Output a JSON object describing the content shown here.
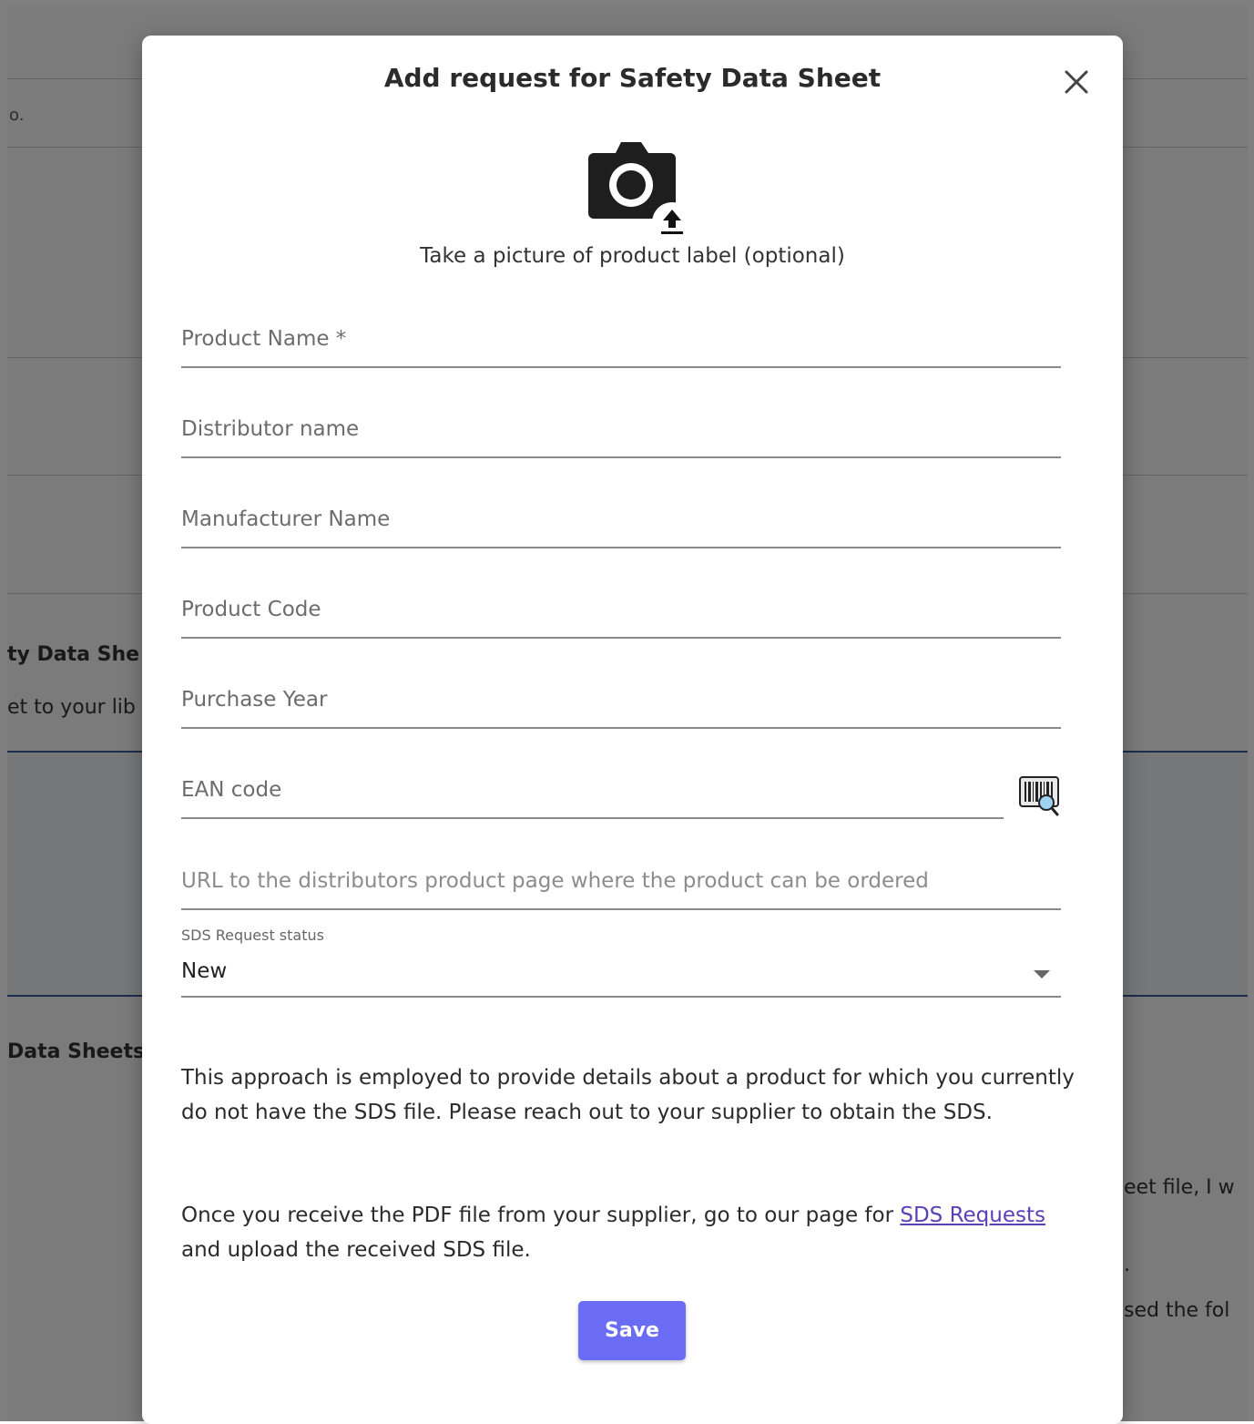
{
  "background": {
    "fragments": [
      {
        "text": "o."
      },
      {
        "text": "ty Data She"
      },
      {
        "text": "et to your lib"
      },
      {
        "text": "Data Sheets"
      },
      {
        "text": "eet file, I w"
      },
      {
        "text": "."
      },
      {
        "text": "sed the fol"
      }
    ]
  },
  "modal": {
    "title": "Add request for Safety Data Sheet",
    "photo_caption": "Take a picture of product label (optional)",
    "fields": {
      "product_name": {
        "placeholder": "Product Name *",
        "value": ""
      },
      "distributor_name": {
        "placeholder": "Distributor name",
        "value": ""
      },
      "manufacturer_name": {
        "placeholder": "Manufacturer Name",
        "value": ""
      },
      "product_code": {
        "placeholder": "Product Code",
        "value": ""
      },
      "purchase_year": {
        "placeholder": "Purchase Year",
        "value": ""
      },
      "ean_code": {
        "placeholder": "EAN code",
        "value": ""
      },
      "url": {
        "placeholder": "URL to the distributors product page where the product can be ordered",
        "value": ""
      }
    },
    "status": {
      "label": "SDS Request status",
      "value": "New"
    },
    "info": {
      "paragraph1": "This approach is employed to provide details about a product for which you currently do not have the SDS file. Please reach out to your supplier to obtain the SDS.",
      "paragraph2_before": "Once you receive the PDF file from your supplier, go to our page for ",
      "paragraph2_link": "SDS Requests",
      "paragraph2_after": " and upload the received SDS file."
    },
    "save_label": "Save"
  },
  "colors": {
    "accent": "#6a6cf6",
    "link": "#5b3fb8",
    "overlay": "rgba(0,0,0,0.5)"
  },
  "icons": [
    "close-icon",
    "camera-upload-icon",
    "barcode-scanner-icon",
    "chevron-down-icon"
  ]
}
